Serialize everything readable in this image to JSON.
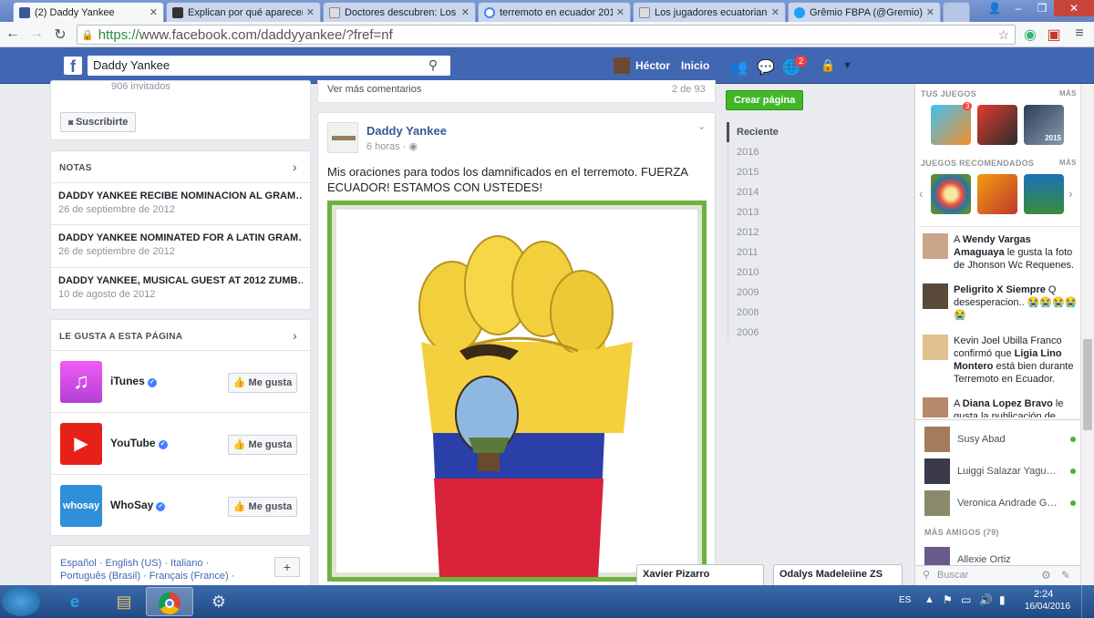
{
  "browser": {
    "tabs": [
      {
        "title": "(2) Daddy Yankee",
        "favicon_color": "#3b5998",
        "active": true
      },
      {
        "title": "Explican por qué aparecen",
        "favicon_color": "#333333",
        "active": false
      },
      {
        "title": "Doctores descubren: Los",
        "favicon_color": "#888888",
        "active": false
      },
      {
        "title": "terremoto en ecuador 201",
        "favicon_color": "#4285f4",
        "active": false
      },
      {
        "title": "Los jugadores ecuatorian",
        "favicon_color": "#888888",
        "active": false
      },
      {
        "title": "Grêmio FBPA (@Gremio)",
        "favicon_color": "#1da1f2",
        "active": false
      }
    ],
    "url_scheme": "https://",
    "url_rest": "www.facebook.com/daddyyankee/?fref=nf"
  },
  "fb_header": {
    "logo": "f",
    "search_value": "Daddy Yankee",
    "user_name": "Héctor",
    "home_label": "Inicio",
    "notification_count": "2"
  },
  "left": {
    "invited_text": "906 invitados",
    "subscribe_label": "Suscribirte",
    "notes_heading": "NOTAS",
    "notes": [
      {
        "title": "DADDY YANKEE RECIBE NOMINACION AL GRAM…",
        "date": "26 de septiembre de 2012"
      },
      {
        "title": "DADDY YANKEE NOMINATED FOR A LATIN GRAM…",
        "date": "26 de septiembre de 2012"
      },
      {
        "title": "DADDY YANKEE, MUSICAL GUEST AT 2012 ZUMB…",
        "date": "10 de agosto de 2012"
      }
    ],
    "likes_heading": "LE GUSTA A ESTA PÁGINA",
    "likes": [
      {
        "name": "iTunes",
        "button": "Me gusta",
        "color": "#d152e0"
      },
      {
        "name": "YouTube",
        "button": "Me gusta",
        "color": "#e62117"
      },
      {
        "name": "WhoSay",
        "button": "Me gusta",
        "color": "#2f8fd8"
      }
    ],
    "languages_line1": "Español · English (US) · Italiano ·",
    "languages_line2": "Português (Brasil) · Français (France) ·",
    "add_label": "+"
  },
  "post": {
    "more_comments": "Ver más comentarios",
    "comments_count": "2 de 93",
    "author": "Daddy Yankee",
    "time": "6 horas ·",
    "text": "Mis oraciones para todos los damnificados en el terremoto. FUERZA ECUADOR! ESTAMOS CON USTEDES!",
    "image_alt": "Puño con la bandera de Ecuador"
  },
  "timeline": {
    "create_page": "Crear página",
    "years": [
      "Reciente",
      "2016",
      "2015",
      "2014",
      "2013",
      "2012",
      "2011",
      "2010",
      "2009",
      "2008",
      "2006"
    ]
  },
  "right": {
    "your_games": "TUS JUEGOS",
    "more": "MÁS",
    "game_badge": "3",
    "game_badge_2": "2015",
    "recommended_games": "JUEGOS RECOMENDADOS",
    "ticker": [
      {
        "pre": "A ",
        "name": "Wendy Vargas Amaguaya",
        "post": " le gusta la foto de Jhonson Wc Requenes."
      },
      {
        "pre": "",
        "name": "Peligrito X Siempre",
        "post": " Q desesperacion.. 😭😭😭😭😭"
      },
      {
        "pre": "Kevin Joel Ubilla Franco confirmó que ",
        "name": "Ligia Lino Montero",
        "post": " está bien durante Terremoto en Ecuador."
      },
      {
        "pre": "A ",
        "name": "Diana Lopez Bravo",
        "post": " le gusta la publicación de"
      }
    ],
    "chat": [
      {
        "name": "Susy Abad"
      },
      {
        "name": "Luiggi Salazar Yagu…"
      },
      {
        "name": "Veronica Andrade G…"
      }
    ],
    "more_friends": "MÁS AMIGOS (79)",
    "chat_more": [
      {
        "name": "Allexie Ortiz"
      }
    ],
    "search_placeholder": "Buscar"
  },
  "chat_tabs": [
    "Xavier Pizarro",
    "Odalys Madeleiine ZS"
  ],
  "taskbar": {
    "lang": "ES",
    "time": "2:24",
    "date": "16/04/2016"
  }
}
